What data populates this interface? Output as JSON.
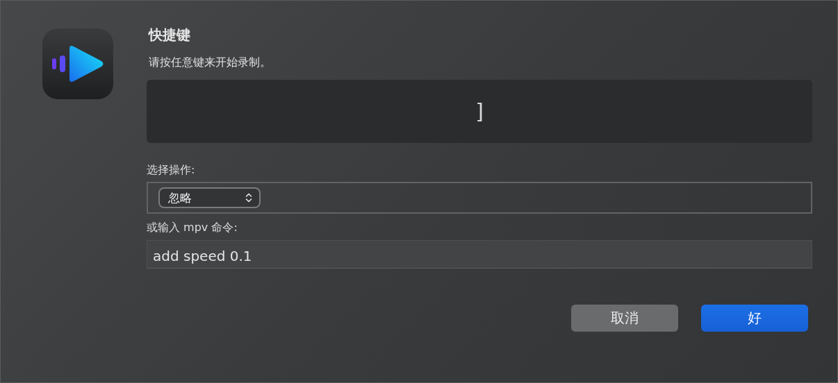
{
  "dialog": {
    "title": "快捷键",
    "message": "请按任意键来开始录制。"
  },
  "recorded_key": "]",
  "action_label": "选择操作:",
  "action_popup": {
    "value": "忽略"
  },
  "command_label": "或输入 mpv 命令:",
  "command_field": {
    "value": "add speed 0.1"
  },
  "buttons": [
    {
      "label": "取消",
      "kind": "cancel"
    },
    {
      "label": "好",
      "kind": "default"
    }
  ]
}
